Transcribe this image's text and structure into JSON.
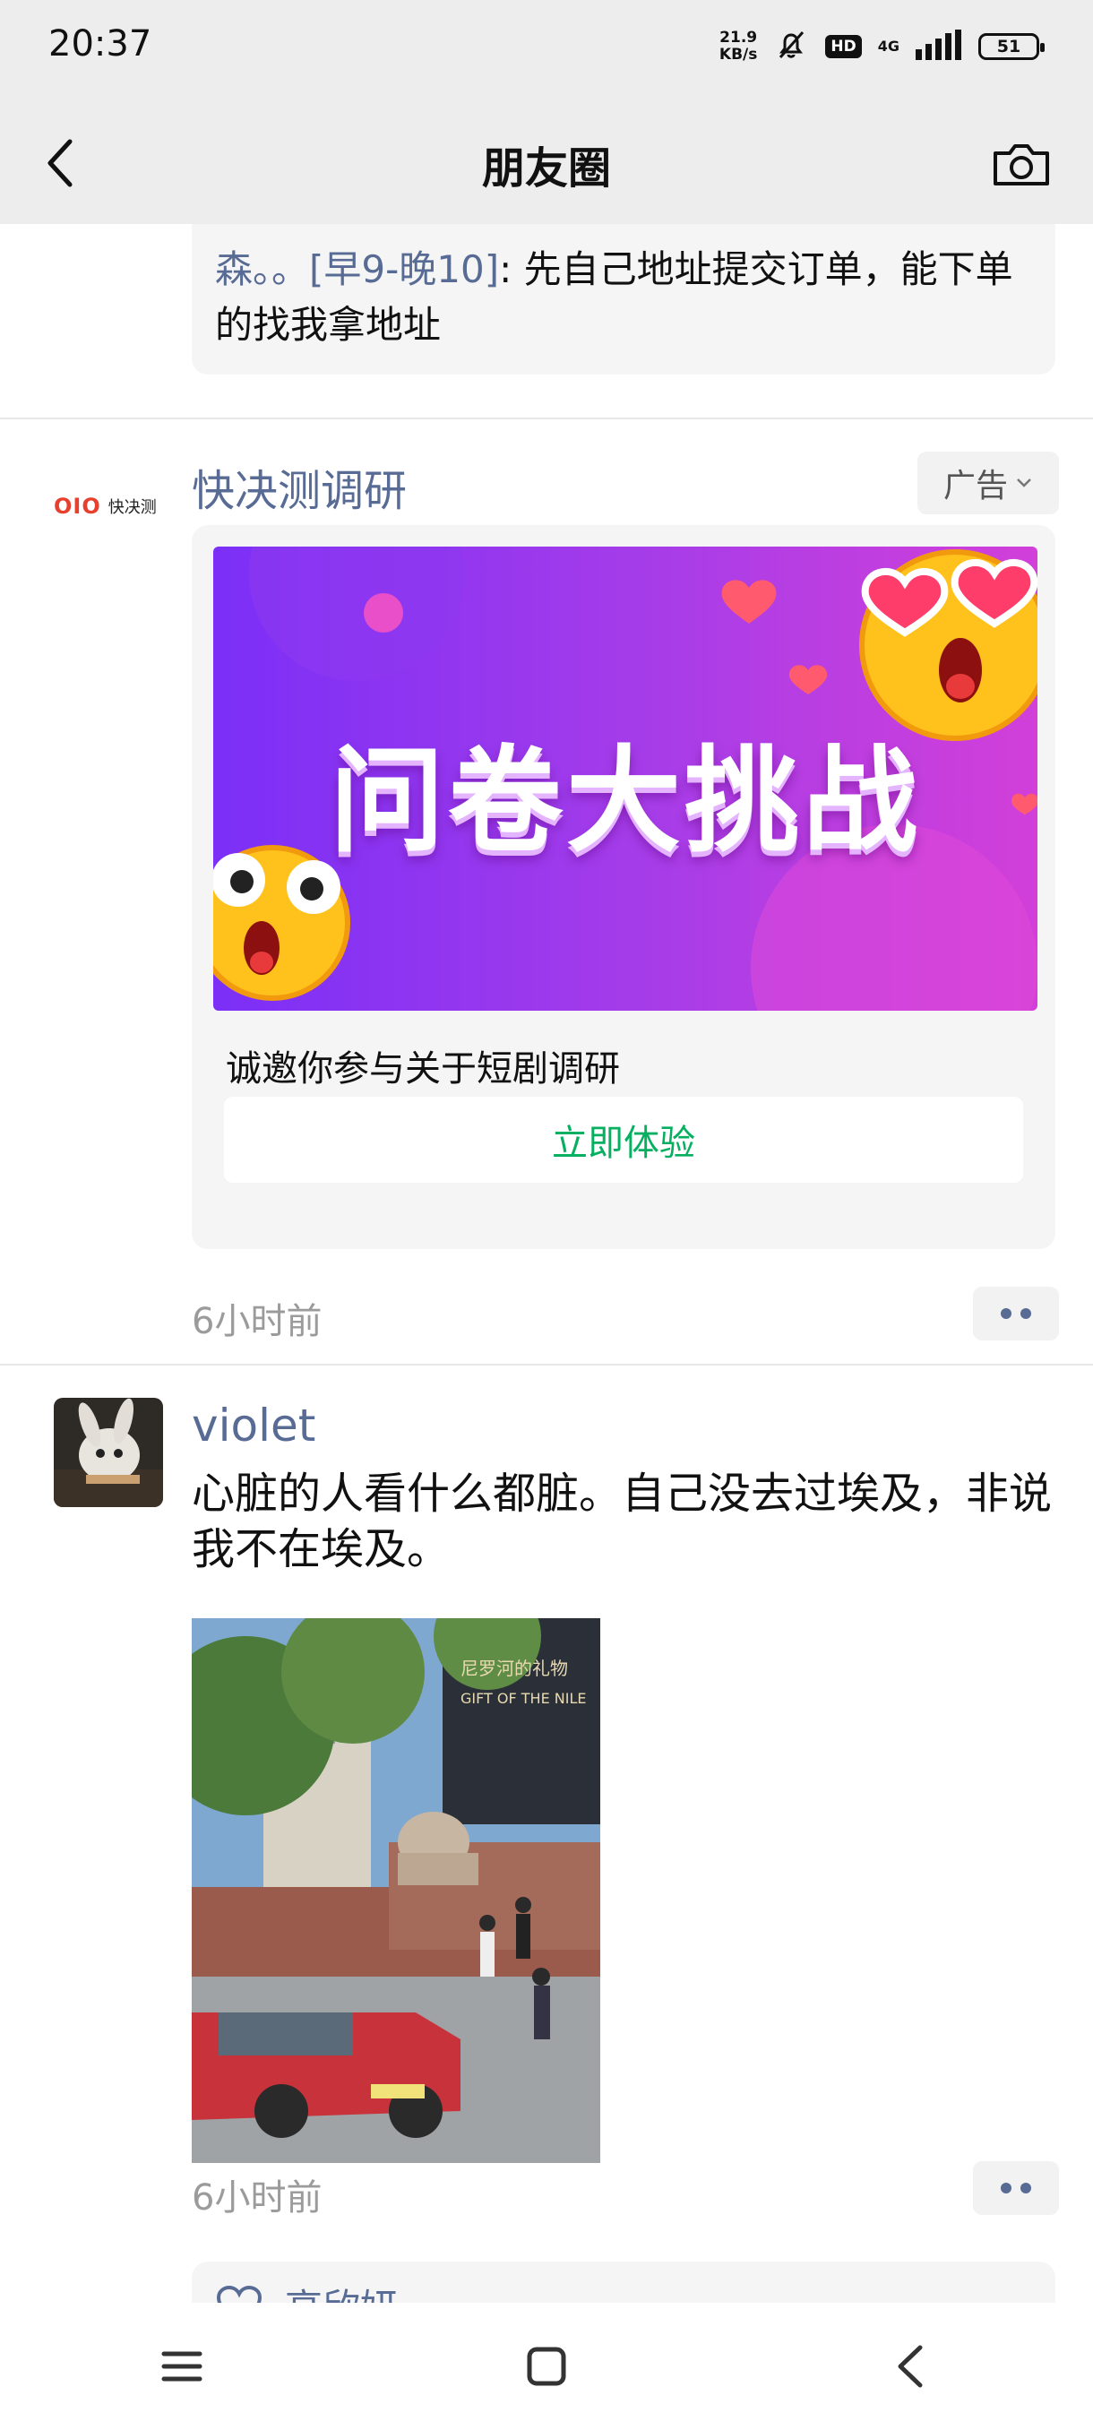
{
  "status_bar": {
    "time": "20:37",
    "network_speed_value": "21.9",
    "network_speed_unit": "KB/s",
    "hd_label": "HD",
    "network_type": "4G",
    "battery": "51"
  },
  "header": {
    "title": "朋友圈"
  },
  "comment": {
    "author": "森。。[早9-晚10]",
    "text": ": 先自己地址提交订单，能下单的找我拿地址"
  },
  "ad": {
    "logo_text": "OIO",
    "logo_name": "快决测",
    "advertiser": "快决测调研",
    "badge_label": "广告",
    "banner_text": "问卷大挑战",
    "description": "诚邀你参与关于短剧调研",
    "cta_label": "立即体验",
    "timestamp": "6小时前"
  },
  "post": {
    "author": "violet",
    "text": "心脏的人看什么都脏。自己没去过埃及，非说我不在埃及。",
    "photo_caption": "尼罗河的礼物",
    "photo_sign": "GIFT OF THE NILE",
    "timestamp": "6小时前"
  },
  "likes": {
    "first_name": "高欣妍"
  },
  "colors": {
    "link": "#576b95",
    "cta_green": "#07b061",
    "header_bg": "#ededed",
    "card_bg": "#f5f5f5"
  },
  "icons": {
    "back": "chevron-left-icon",
    "camera": "camera-icon",
    "more": "two-dots-icon",
    "like": "heart-outline-icon",
    "nav": [
      "menu-icon",
      "home-square-icon",
      "back-triangle-icon"
    ]
  }
}
